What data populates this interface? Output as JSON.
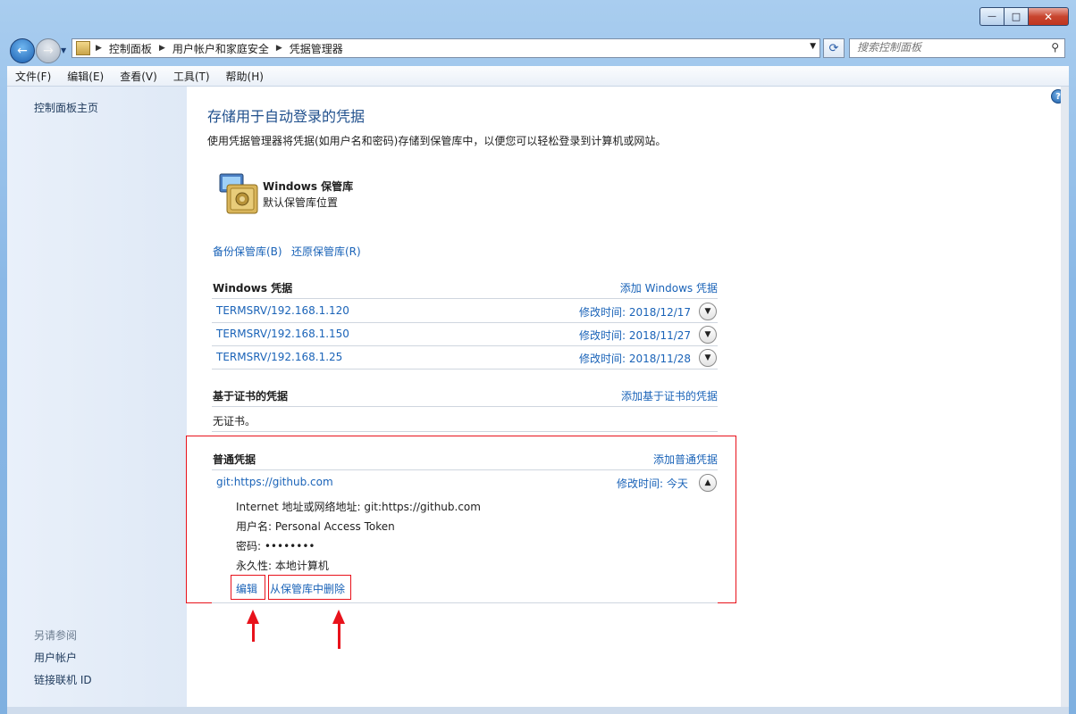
{
  "window": {
    "minimize": "—",
    "maximize": "□",
    "close": "✕"
  },
  "nav": {
    "back": "←",
    "forward": "→",
    "breadcrumbs": [
      "控制面板",
      "用户帐户和家庭安全",
      "凭据管理器"
    ],
    "search_placeholder": "搜索控制面板"
  },
  "menubar": [
    "文件(F)",
    "编辑(E)",
    "查看(V)",
    "工具(T)",
    "帮助(H)"
  ],
  "sidebar": {
    "home": "控制面板主页",
    "see_also": "另请参阅",
    "links": [
      "用户帐户",
      "链接联机 ID"
    ]
  },
  "main": {
    "title": "存储用于自动登录的凭据",
    "description": "使用凭据管理器将凭据(如用户名和密码)存储到保管库中，以便您可以轻松登录到计算机或网站。",
    "vault": {
      "name": "Windows 保管库",
      "location": "默认保管库位置"
    },
    "backup_link": "备份保管库(B)",
    "restore_link": "还原保管库(R)",
    "windows_creds": {
      "title": "Windows 凭据",
      "add": "添加 Windows 凭据",
      "items": [
        {
          "name": "TERMSRV/192.168.1.120",
          "modified": "修改时间:  2018/12/17"
        },
        {
          "name": "TERMSRV/192.168.1.150",
          "modified": "修改时间:  2018/11/27"
        },
        {
          "name": "TERMSRV/192.168.1.25",
          "modified": "修改时间:  2018/11/28"
        }
      ]
    },
    "cert_creds": {
      "title": "基于证书的凭据",
      "add": "添加基于证书的凭据",
      "empty": "无证书。"
    },
    "generic_creds": {
      "title": "普通凭据",
      "add": "添加普通凭据",
      "item": {
        "name": "git:https://github.com",
        "modified": "修改时间:  今天",
        "address": "Internet 地址或网络地址:  git:https://github.com",
        "username": "用户名:  Personal Access Token",
        "password": "密码:  ••••••••",
        "persistence": "永久性:  本地计算机",
        "edit": "编辑",
        "delete": "从保管库中删除"
      }
    }
  },
  "colors": {
    "accent_link": "#1a63b8",
    "annotation_red": "#e8121b",
    "title_blue": "#1f4f8c"
  }
}
